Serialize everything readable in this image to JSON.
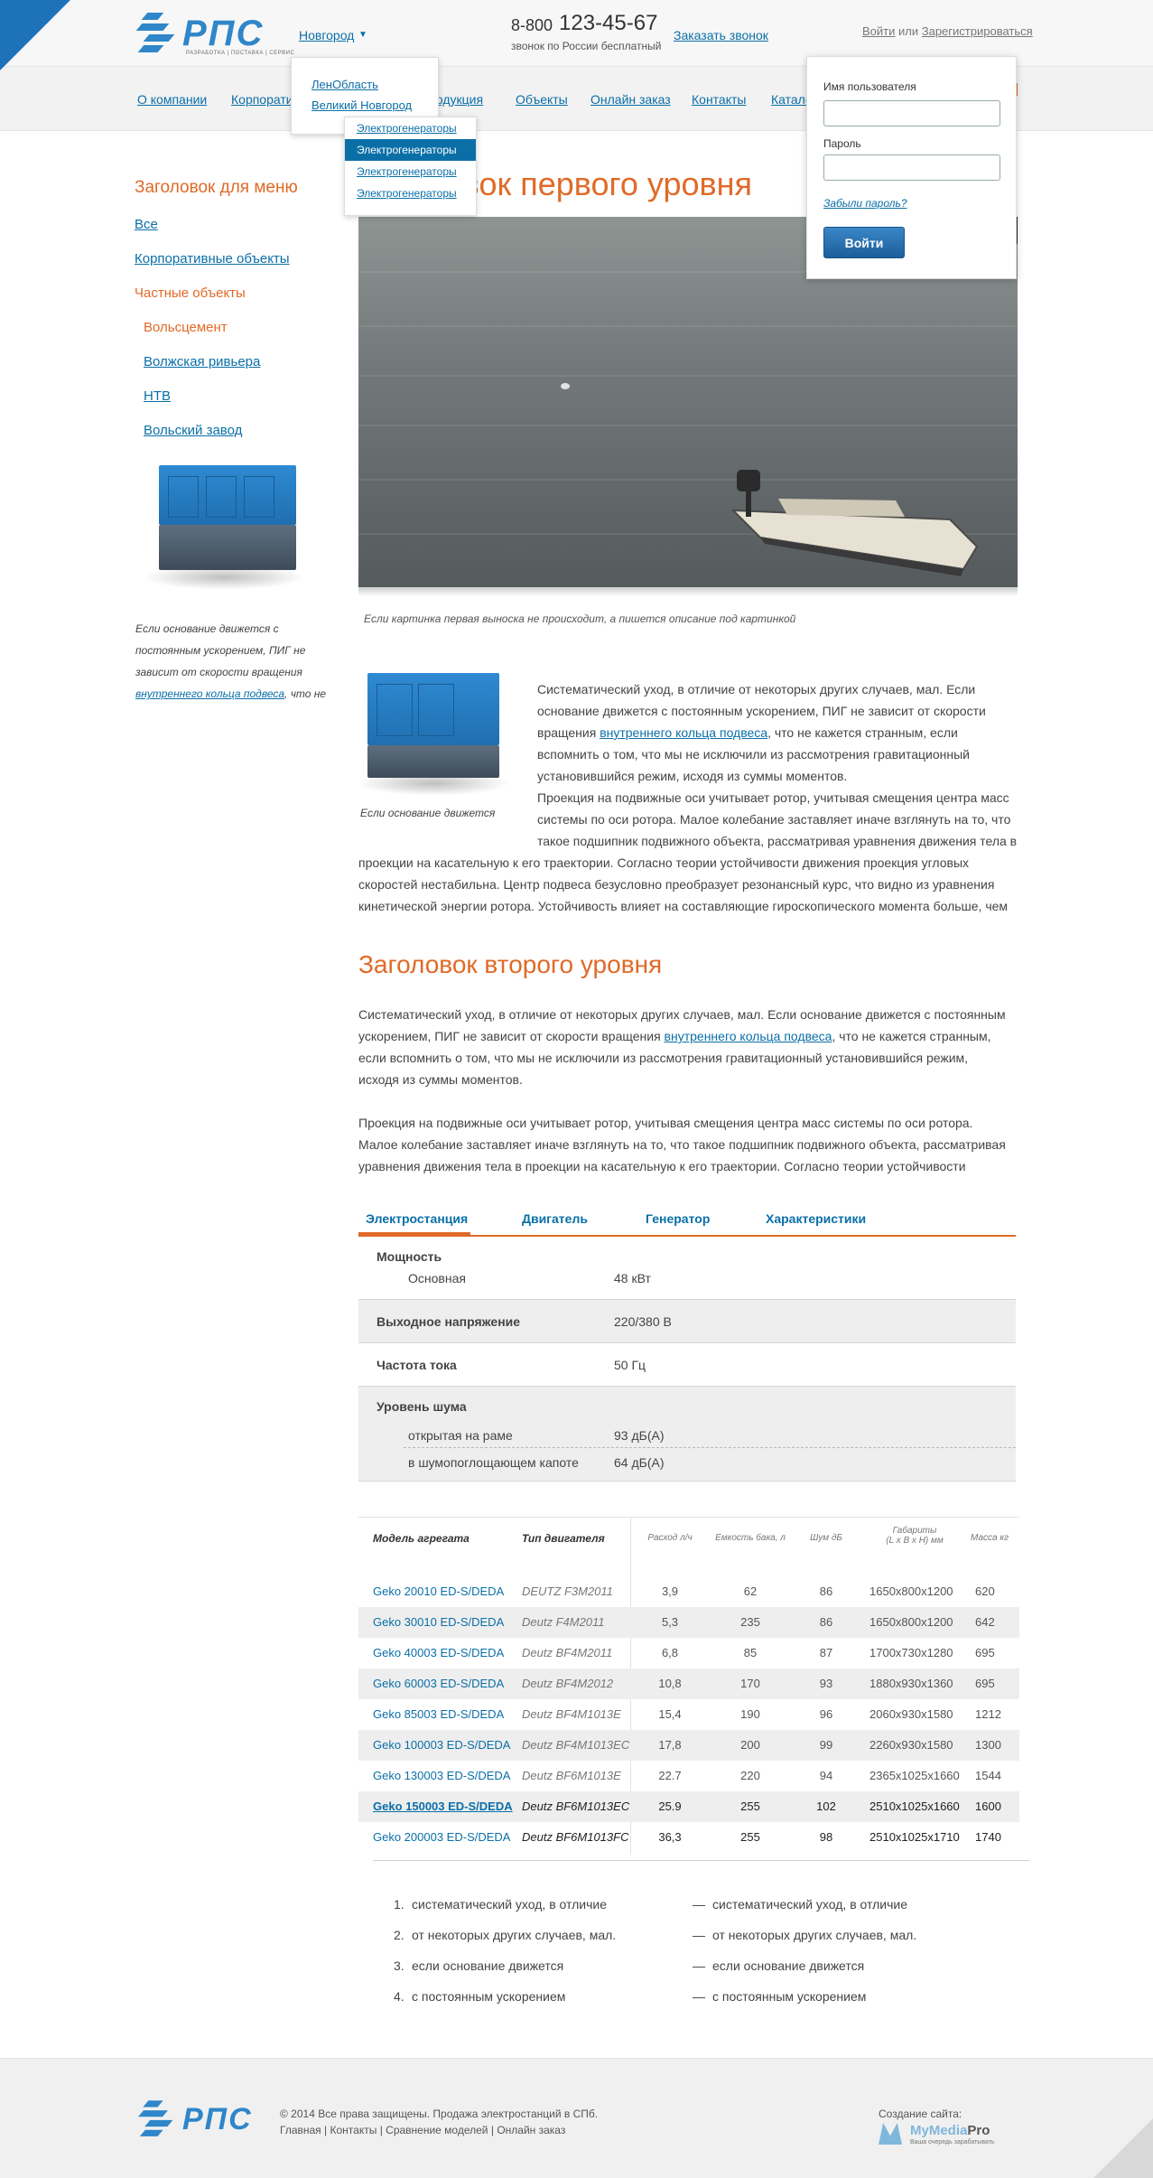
{
  "brand": {
    "name": "РПС",
    "tagline": "РАЗРАБОТКА | ПОСТАВКА | СЕРВИС"
  },
  "header": {
    "city": "Новгород",
    "phone_prefix": "8-800",
    "phone_number": "123-45-67",
    "phone_note": "звонок по России бесплатный",
    "order_call": "Заказать звонок",
    "login_link": "Войти",
    "or_text": "или",
    "register_link": "Зарегистрироваться"
  },
  "city_dropdown": [
    "ЛенОбласть",
    "Великий Новгород"
  ],
  "nav": [
    "О компании",
    "Корпоративные",
    "Продукция",
    "Объекты",
    "Онлайн заказ",
    "Контакты",
    "Каталог"
  ],
  "nav_dropdown": [
    "Электрогенераторы",
    "Электрогенераторы",
    "Электрогенераторы",
    "Электрогенераторы"
  ],
  "login": {
    "username_label": "Имя пользователя",
    "password_label": "Пароль",
    "forgot": "Забыли пароль?",
    "submit": "Войти"
  },
  "sidebar": {
    "title": "Заголовок для меню",
    "items": [
      "Все",
      "Корпоративные объекты",
      "Частные объекты",
      "Вольсцемент",
      "Волжская ривьера",
      "НТВ",
      "Вольский завод"
    ],
    "caption_before": "Если основание движется с постоянным ускорением, ПИГ не зависит от скорости вращения",
    "caption_link": "внутреннего кольца подвеса",
    "caption_after": ", что не"
  },
  "main": {
    "h1": "Заголовок первого уровня",
    "photo_caption": "Если картинка первая выноска не происходит, а пишется описание под картинкой",
    "float_caption": "Если основание движется",
    "p1_line1": "Систематический уход, в отличие от некоторых других случаев, мал. Если",
    "p1_line2": "основание движется с постоянным ускорением, ПИГ не зависит от скорости",
    "p1_line3a": "вращения ",
    "p1_link": "внутреннего кольца подвеса",
    "p1_line3b": ", что не кажется странным, если",
    "p1_line4": "вспомнить о том, что мы не исключили из рассмотрения гравитационный",
    "p1_line5": "установившийся режим, исходя из суммы моментов.",
    "p1_line6": "Проекция на подвижные оси учитывает ротор, учитывая смещения центра масс",
    "p1_line7": "системы по оси ротора. Малое колебание заставляет иначе взглянуть на то, что",
    "p1_line8": "такое подшипник подвижного объекта, рассматривая уравнения движения тела в",
    "p1_line9": "проекции на касательную к его траектории. Согласно теории устойчивости движения проекция угловых",
    "p1_line10": "скоростей нестабильна. Центр подвеса безусловно преобразует резонансный курс, что видно из уравнения",
    "p1_line11": "кинетической энергии ротора. Устойчивость влияет на составляющие гироскопического момента больше, чем",
    "h2": "Заголовок второго уровня",
    "p2_line1": "Систематический уход, в отличие от некоторых других случаев, мал. Если основание движется с постоянным",
    "p2_line2a": "ускорением, ПИГ не зависит от скорости вращения ",
    "p2_link": "внутреннего кольца подвеса",
    "p2_line2b": ", что не кажется странным,",
    "p2_line3": "если вспомнить о том, что мы не исключили из рассмотрения гравитационный установившийся режим,",
    "p2_line4": "исходя из суммы моментов.",
    "p3_line1": "Проекция на подвижные оси учитывает ротор, учитывая смещения центра масс системы по оси ротора.",
    "p3_line2": "Малое колебание заставляет иначе взглянуть на то, что такое подшипник подвижного объекта, рассматривая",
    "p3_line3": "уравнения движения тела в проекции на касательную к его траектории. Согласно теории устойчивости"
  },
  "tabs": [
    "Электростанция",
    "Двигатель",
    "Генератор",
    "Характеристики"
  ],
  "specs": {
    "power_label": "Мощность",
    "power_main_label": "Основная",
    "power_main_value": "48 кВт",
    "voltage_label": "Выходное напряжение",
    "voltage_value": "220/380 В",
    "freq_label": "Частота тока",
    "freq_value": "50 Гц",
    "noise_label": "Уровень шума",
    "noise_open_label": "открытая на раме",
    "noise_open_value": "93 дБ(А)",
    "noise_hood_label": "в шумопоглощающем капоте",
    "noise_hood_value": "64 дБ(А)"
  },
  "models_table": {
    "headers": {
      "model": "Модель агрегата",
      "engine": "Тип двигателя",
      "consumption": "Расход л/ч",
      "tank": "Емкость бака, л",
      "noise": "Шум дБ",
      "dims_1": "Габариты",
      "dims_2": "(L х B х H) мм",
      "mass": "Масса кг"
    },
    "rows": [
      {
        "model": "Geko 20010 ED-S/DEDA",
        "engine": "DEUTZ F3M2011",
        "consumption": "3,9",
        "tank": "62",
        "noise": "86",
        "dims": "1650x800x1200",
        "mass": "620"
      },
      {
        "model": "Geko 30010 ED-S/DEDA",
        "engine": "Deutz F4M2011",
        "consumption": "5,3",
        "tank": "235",
        "noise": "86",
        "dims": "1650x800x1200",
        "mass": "642"
      },
      {
        "model": "Geko 40003 ED-S/DEDA",
        "engine": "Deutz BF4M2011",
        "consumption": "6,8",
        "tank": "85",
        "noise": "87",
        "dims": "1700x730x1280",
        "mass": "695"
      },
      {
        "model": "Geko 60003 ED-S/DEDA",
        "engine": "Deutz BF4M2012",
        "consumption": "10,8",
        "tank": "170",
        "noise": "93",
        "dims": "1880x930x1360",
        "mass": "695"
      },
      {
        "model": "Geko 85003 ED-S/DEDA",
        "engine": "Deutz BF4M1013E",
        "consumption": "15,4",
        "tank": "190",
        "noise": "96",
        "dims": "2060x930x1580",
        "mass": "1212"
      },
      {
        "model": "Geko 100003 ED-S/DEDA",
        "engine": "Deutz BF4M1013EC",
        "consumption": "17,8",
        "tank": "200",
        "noise": "99",
        "dims": "2260x930x1580",
        "mass": "1300"
      },
      {
        "model": "Geko 130003 ED-S/DEDA",
        "engine": "Deutz BF6M1013E",
        "consumption": "22.7",
        "tank": "220",
        "noise": "94",
        "dims": "2365x1025x1660",
        "mass": "1544"
      },
      {
        "model": "Geko 150003 ED-S/DEDA",
        "engine": "Deutz BF6M1013EC",
        "consumption": "25.9",
        "tank": "255",
        "noise": "102",
        "dims": "2510x1025x1660",
        "mass": "1600"
      },
      {
        "model": "Geko 200003 ED-S/DEDA",
        "engine": "Deutz BF6M1013FC",
        "consumption": "36,3",
        "tank": "255",
        "noise": "98",
        "dims": "2510x1025x1710",
        "mass": "1740"
      }
    ]
  },
  "lists": {
    "ordered": [
      "систематический уход, в отличие",
      "от некоторых других случаев, мал.",
      "если основание движется",
      "с постоянным ускорением"
    ],
    "dashed": [
      "систематический уход, в отличие",
      "от некоторых других случаев, мал.",
      "если основание движется",
      "с постоянным ускорением"
    ],
    "dash": "—",
    "numbers": [
      "1.",
      "2.",
      "3.",
      "4."
    ]
  },
  "footer": {
    "copyright": "© 2014 Все права защищены. Продажа электростанций в СПб.",
    "links": [
      "Главная",
      "Контакты",
      "Сравнение моделей",
      "Онлайн заказ"
    ],
    "separator": "|",
    "created_label": "Создание сайта:",
    "dev_name_a": "MyMedia",
    "dev_name_b": "Pro",
    "dev_slogan": "Ваша очередь зарабатывать"
  },
  "colors": {
    "accent": "#e06a28",
    "link": "#0a6fa8",
    "brand_blue": "#2f86c9",
    "active_bg": "#0b6fa7"
  }
}
